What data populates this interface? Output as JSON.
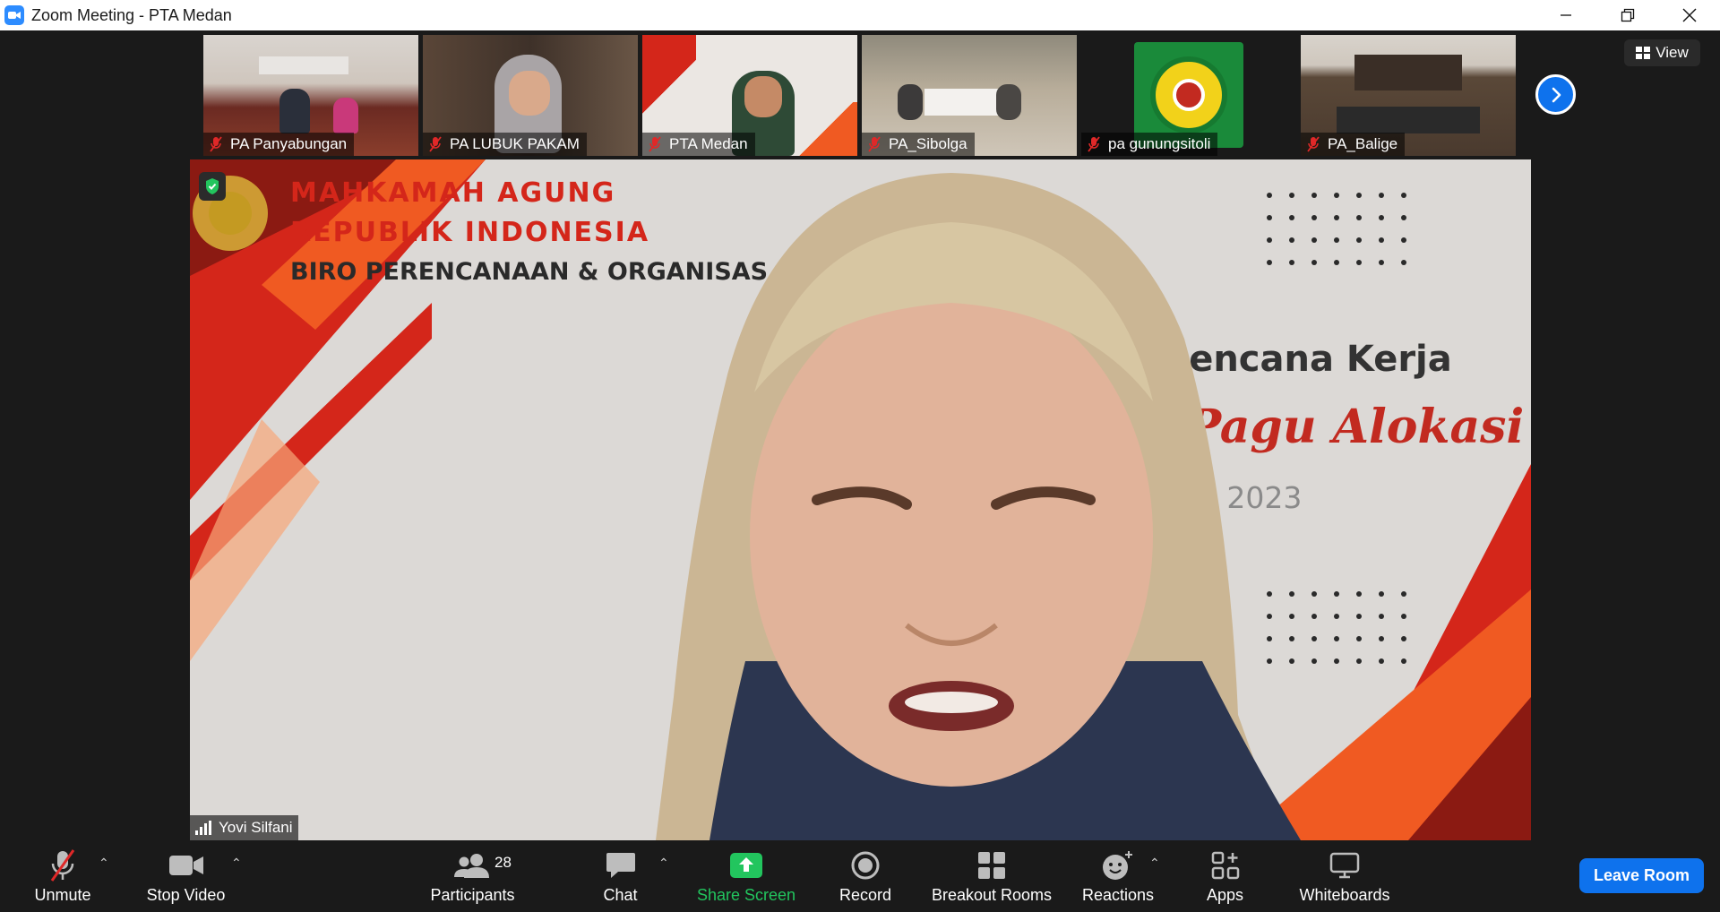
{
  "window": {
    "title": "Zoom Meeting - PTA Medan"
  },
  "top_right": {
    "view_label": "View"
  },
  "thumbnails": [
    {
      "name": "PA Panyabungan",
      "bg": "#7b5a47"
    },
    {
      "name": "PA LUBUK PAKAM",
      "bg": "#4a3a30"
    },
    {
      "name": "PTA Medan",
      "bg": "#e9e4e0"
    },
    {
      "name": "PA_Sibolga",
      "bg": "#8d7c68"
    },
    {
      "name": "pa gunungsitoli",
      "bg": "#1a1a1a"
    },
    {
      "name": "PA_Balige",
      "bg": "#5b4a3e"
    }
  ],
  "main_video": {
    "speaker": "Yovi Silfani",
    "slide": {
      "line1": "MAHKAMAH AGUNG",
      "line2": "REPUBLIK INDONESIA",
      "line3": "BIRO PERENCANAAN & ORGANISAS",
      "title_right": "n Rencana Kerja",
      "script_right": "Pagu Alokasi",
      "year_right": "RAN 2023"
    }
  },
  "toolbar": {
    "unmute": "Unmute",
    "stop_video": "Stop Video",
    "participants": "Participants",
    "participants_count": "28",
    "chat": "Chat",
    "share_screen": "Share Screen",
    "record": "Record",
    "breakout_rooms": "Breakout Rooms",
    "reactions": "Reactions",
    "apps": "Apps",
    "whiteboards": "Whiteboards",
    "leave_room": "Leave Room"
  },
  "colors": {
    "accent": "#0e72ed",
    "share_green": "#22c55e",
    "slide_red": "#d4261a",
    "slide_orange": "#f05a22"
  }
}
